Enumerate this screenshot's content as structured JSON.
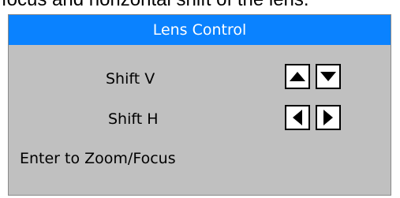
{
  "caption": "focus and horizontal shift of the lens.",
  "panel": {
    "title": "Lens Control",
    "shift_v": {
      "label": "Shift V",
      "up_icon": "triangle-up-icon",
      "down_icon": "triangle-down-icon"
    },
    "shift_h": {
      "label": "Shift H",
      "left_icon": "triangle-left-icon",
      "right_icon": "triangle-right-icon"
    },
    "hint": "Enter to Zoom/Focus"
  },
  "colors": {
    "title_bar": "#0a82ff",
    "panel_bg": "#c0c0c0",
    "button_bg": "#ffffff",
    "icon": "#000000"
  }
}
